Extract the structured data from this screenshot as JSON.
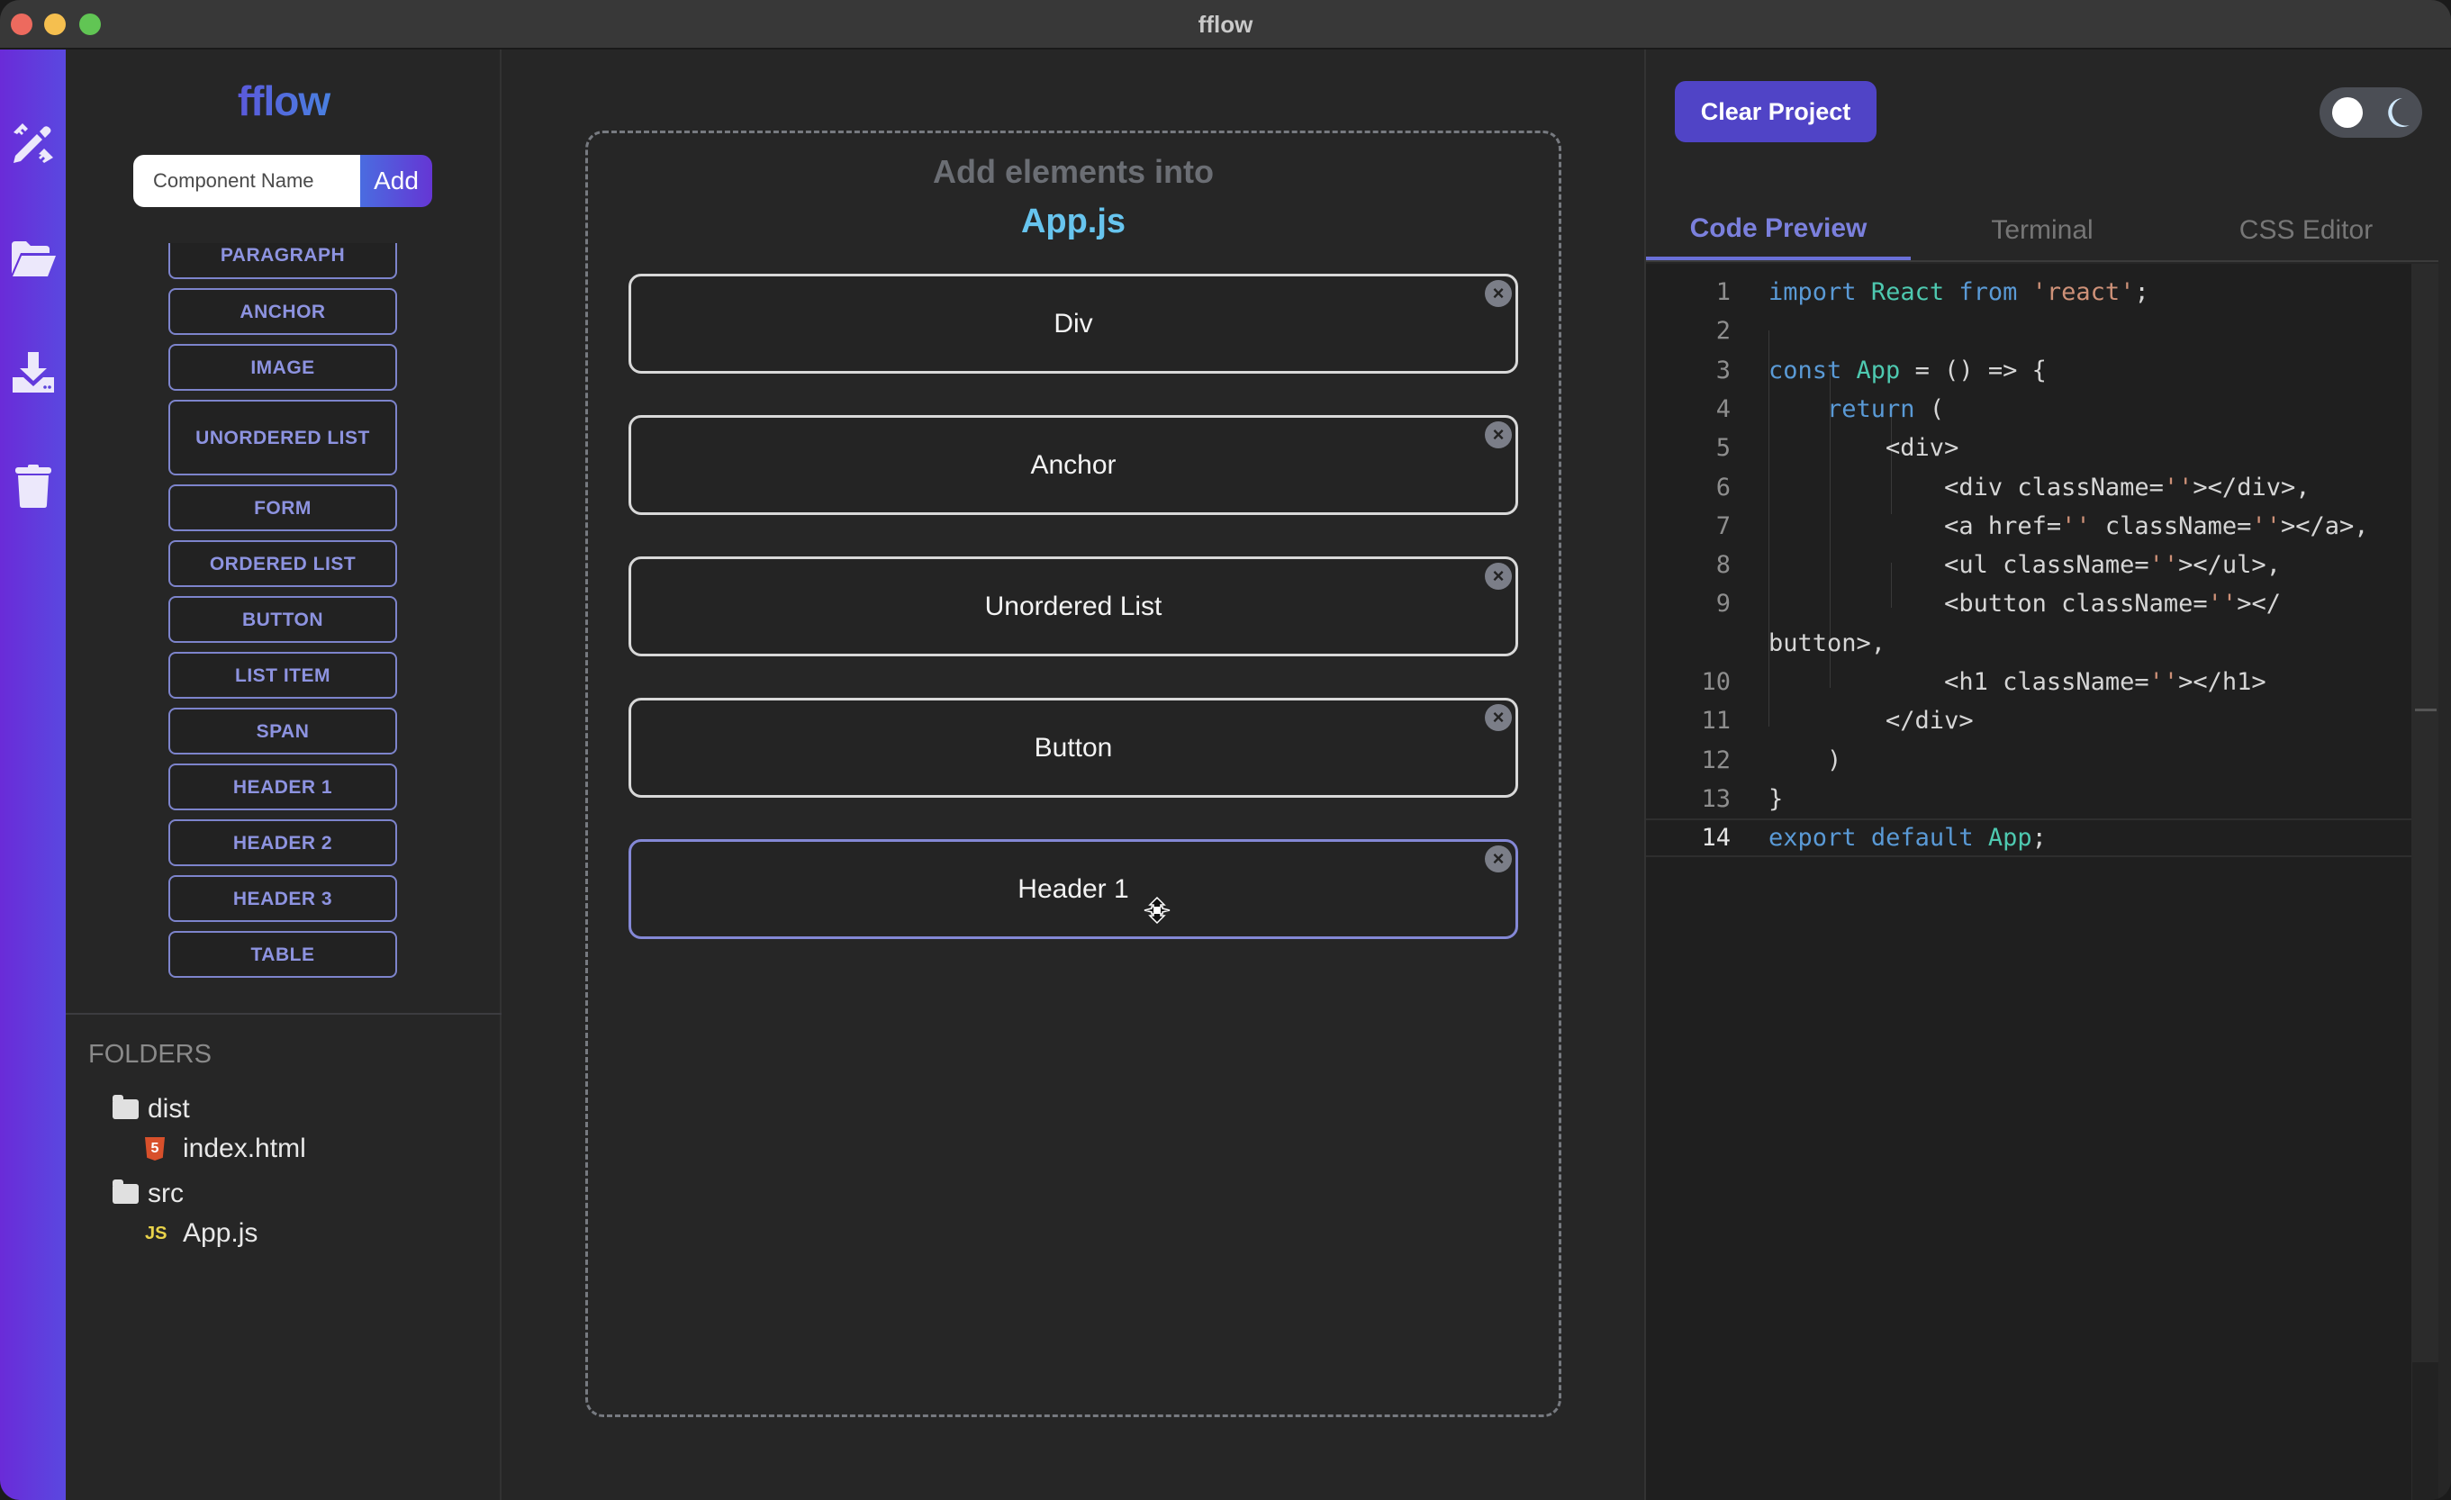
{
  "window": {
    "title": "fflow"
  },
  "iconbar": {
    "items": [
      {
        "icon": "design-tools-icon",
        "label": "Components"
      },
      {
        "icon": "folder-open-icon",
        "label": "Open"
      },
      {
        "icon": "download-icon",
        "label": "Export"
      },
      {
        "icon": "trash-icon",
        "label": "Delete"
      }
    ]
  },
  "sidebar": {
    "logo": "fflow",
    "component_input": {
      "placeholder": "Component Name",
      "value": ""
    },
    "add_label": "Add",
    "components": [
      "PARAGRAPH",
      "ANCHOR",
      "IMAGE",
      "UNORDERED LIST",
      "FORM",
      "ORDERED LIST",
      "BUTTON",
      "LIST ITEM",
      "SPAN",
      "HEADER 1",
      "HEADER 2",
      "HEADER 3",
      "TABLE"
    ],
    "folders_label": "FOLDERS",
    "tree": [
      {
        "type": "folder",
        "name": "dist"
      },
      {
        "type": "html-file",
        "icon_text": "5",
        "name": "index.html"
      },
      {
        "type": "folder",
        "name": "src"
      },
      {
        "type": "js-file",
        "icon_text": "JS",
        "name": "App.js"
      }
    ]
  },
  "canvas": {
    "heading": "Add elements into",
    "file": "App.js",
    "elements": [
      "Div",
      "Anchor",
      "Unordered List",
      "Button",
      "Header 1"
    ],
    "close_glyph": "×"
  },
  "right": {
    "clear_label": "Clear Project",
    "theme_toggle": "dark",
    "tabs": [
      "Code Preview",
      "Terminal",
      "CSS Editor"
    ],
    "active_tab": "Code Preview",
    "code_lines": [
      {
        "n": "1",
        "text": "import React from 'react';"
      },
      {
        "n": "2",
        "text": ""
      },
      {
        "n": "3",
        "text": "const App = () => {"
      },
      {
        "n": "4",
        "text": "    return ("
      },
      {
        "n": "5",
        "text": "        <div>"
      },
      {
        "n": "6",
        "text": "            <div className=''></div>,"
      },
      {
        "n": "7",
        "text": "            <a href='' className=''></a>,"
      },
      {
        "n": "8",
        "text": "            <ul className=''></ul>,"
      },
      {
        "n": "9",
        "text": "            <button className=''></"
      },
      {
        "n": "",
        "text": "button>,"
      },
      {
        "n": "10",
        "text": "            <h1 className=''></h1>"
      },
      {
        "n": "11",
        "text": "        </div>"
      },
      {
        "n": "12",
        "text": "    )"
      },
      {
        "n": "13",
        "text": "}"
      },
      {
        "n": "14",
        "text": "export default App;"
      }
    ],
    "current_line": "14"
  },
  "colors": {
    "accent": "#5044c6",
    "tab_active": "#7b80dd",
    "component_button": "#8d93e0",
    "canvas_file": "#67c4ee",
    "iconbar_start": "#6a2bd8",
    "iconbar_end": "#5a48e0"
  }
}
